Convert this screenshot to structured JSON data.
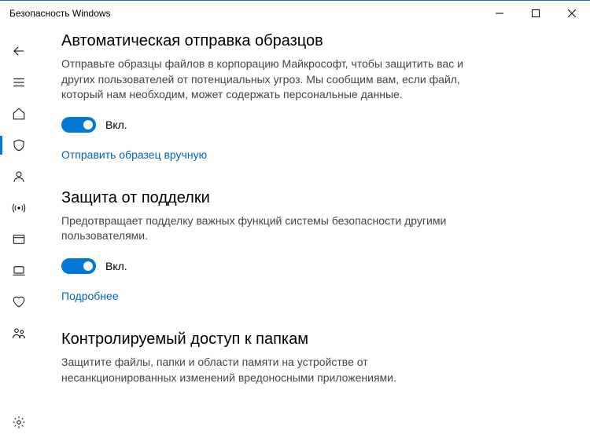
{
  "window": {
    "title": "Безопасность Windows"
  },
  "sections": {
    "sample_submission": {
      "title": "Автоматическая отправка образцов",
      "description": "Отправьте образцы файлов в корпорацию Майкрософт, чтобы защитить вас и других пользователей от потенциальных угроз. Мы сообщим вам, если файл, который нам необходим, может содержать персональные данные.",
      "toggle_state": "Вкл.",
      "link": "Отправить образец вручную"
    },
    "tamper_protection": {
      "title": "Защита от подделки",
      "description": "Предотвращает подделку важных функций системы безопасности другими пользователями.",
      "toggle_state": "Вкл.",
      "link": "Подробнее"
    },
    "controlled_folder_access": {
      "title": "Контролируемый доступ к папкам",
      "description": "Защитите файлы, папки и области памяти на устройстве от несанкционированных изменений вредоносными приложениями."
    }
  }
}
